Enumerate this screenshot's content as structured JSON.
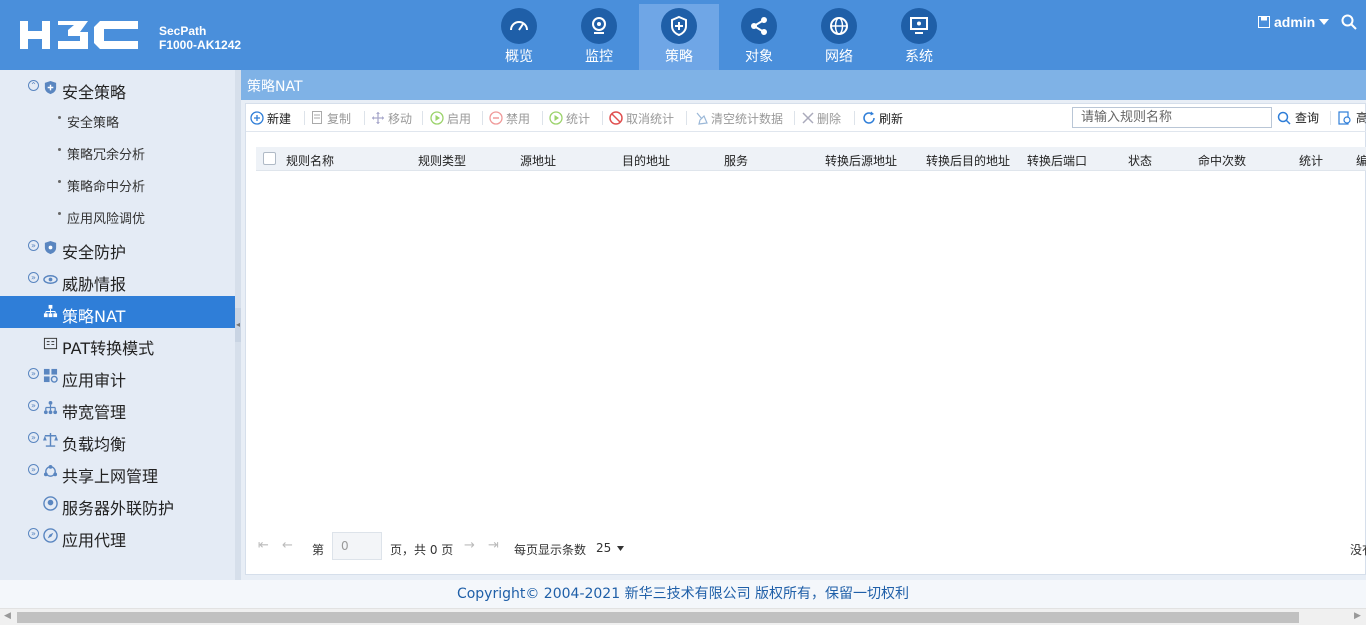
{
  "brand": {
    "logo": "H3C",
    "product_line1": "SecPath",
    "product_line2": "F1000-AK1242"
  },
  "nav": [
    {
      "label": "概览",
      "icon": "dashboard-icon"
    },
    {
      "label": "监控",
      "icon": "camera-icon"
    },
    {
      "label": "策略",
      "icon": "shield-icon",
      "active": true
    },
    {
      "label": "对象",
      "icon": "share-icon"
    },
    {
      "label": "网络",
      "icon": "globe-icon"
    },
    {
      "label": "系统",
      "icon": "monitor-icon"
    }
  ],
  "user": {
    "name": "admin"
  },
  "sidebar": {
    "groups": [
      {
        "label": "安全策略",
        "icon": "shield-icon",
        "toggle": "expanded"
      },
      {
        "label": "安全防护",
        "icon": "shield-icon",
        "toggle": "collapsed"
      },
      {
        "label": "威胁情报",
        "icon": "eye-icon",
        "toggle": "collapsed"
      },
      {
        "label": "策略NAT",
        "icon": "network-icon",
        "active": true
      },
      {
        "label": "PAT转换模式",
        "icon": "list-icon"
      },
      {
        "label": "应用审计",
        "icon": "grid-icon",
        "toggle": "collapsed"
      },
      {
        "label": "带宽管理",
        "icon": "tree-icon",
        "toggle": "collapsed"
      },
      {
        "label": "负载均衡",
        "icon": "balance-icon",
        "toggle": "collapsed"
      },
      {
        "label": "共享上网管理",
        "icon": "share-icon",
        "toggle": "collapsed"
      },
      {
        "label": "服务器外联防护",
        "icon": "server-icon"
      },
      {
        "label": "应用代理",
        "icon": "compass-icon",
        "toggle": "collapsed"
      }
    ],
    "sub_items": [
      "安全策略",
      "策略冗余分析",
      "策略命中分析",
      "应用风险调优"
    ]
  },
  "page": {
    "title": "策略NAT"
  },
  "toolbar": {
    "new": "新建",
    "copy": "复制",
    "move": "移动",
    "enable": "启用",
    "disable": "禁用",
    "stats": "统计",
    "cancel_stats": "取消统计",
    "clear_stats": "清空统计数据",
    "delete": "删除",
    "refresh": "刷新",
    "search_placeholder": "请输入规则名称",
    "query": "查询",
    "advanced": "高"
  },
  "table": {
    "columns": [
      "规则名称",
      "规则类型",
      "源地址",
      "目的地址",
      "服务",
      "转换后源地址",
      "转换后目的地址",
      "转换后端口",
      "状态",
      "命中次数",
      "统计",
      "编"
    ]
  },
  "pager": {
    "page_prefix": "第",
    "page_value": "0",
    "page_suffix": "页，共 0 页",
    "per_page_label": "每页显示条数",
    "per_page_value": "25",
    "right_text": "没有"
  },
  "footer": {
    "copyright": "Copyright© 2004-2021 新华三技术有限公司 版权所有，保留一切权利"
  },
  "colors": {
    "header": "#4a8fdb",
    "accent": "#2f7ed8",
    "title_bar": "#7fb2e6"
  }
}
